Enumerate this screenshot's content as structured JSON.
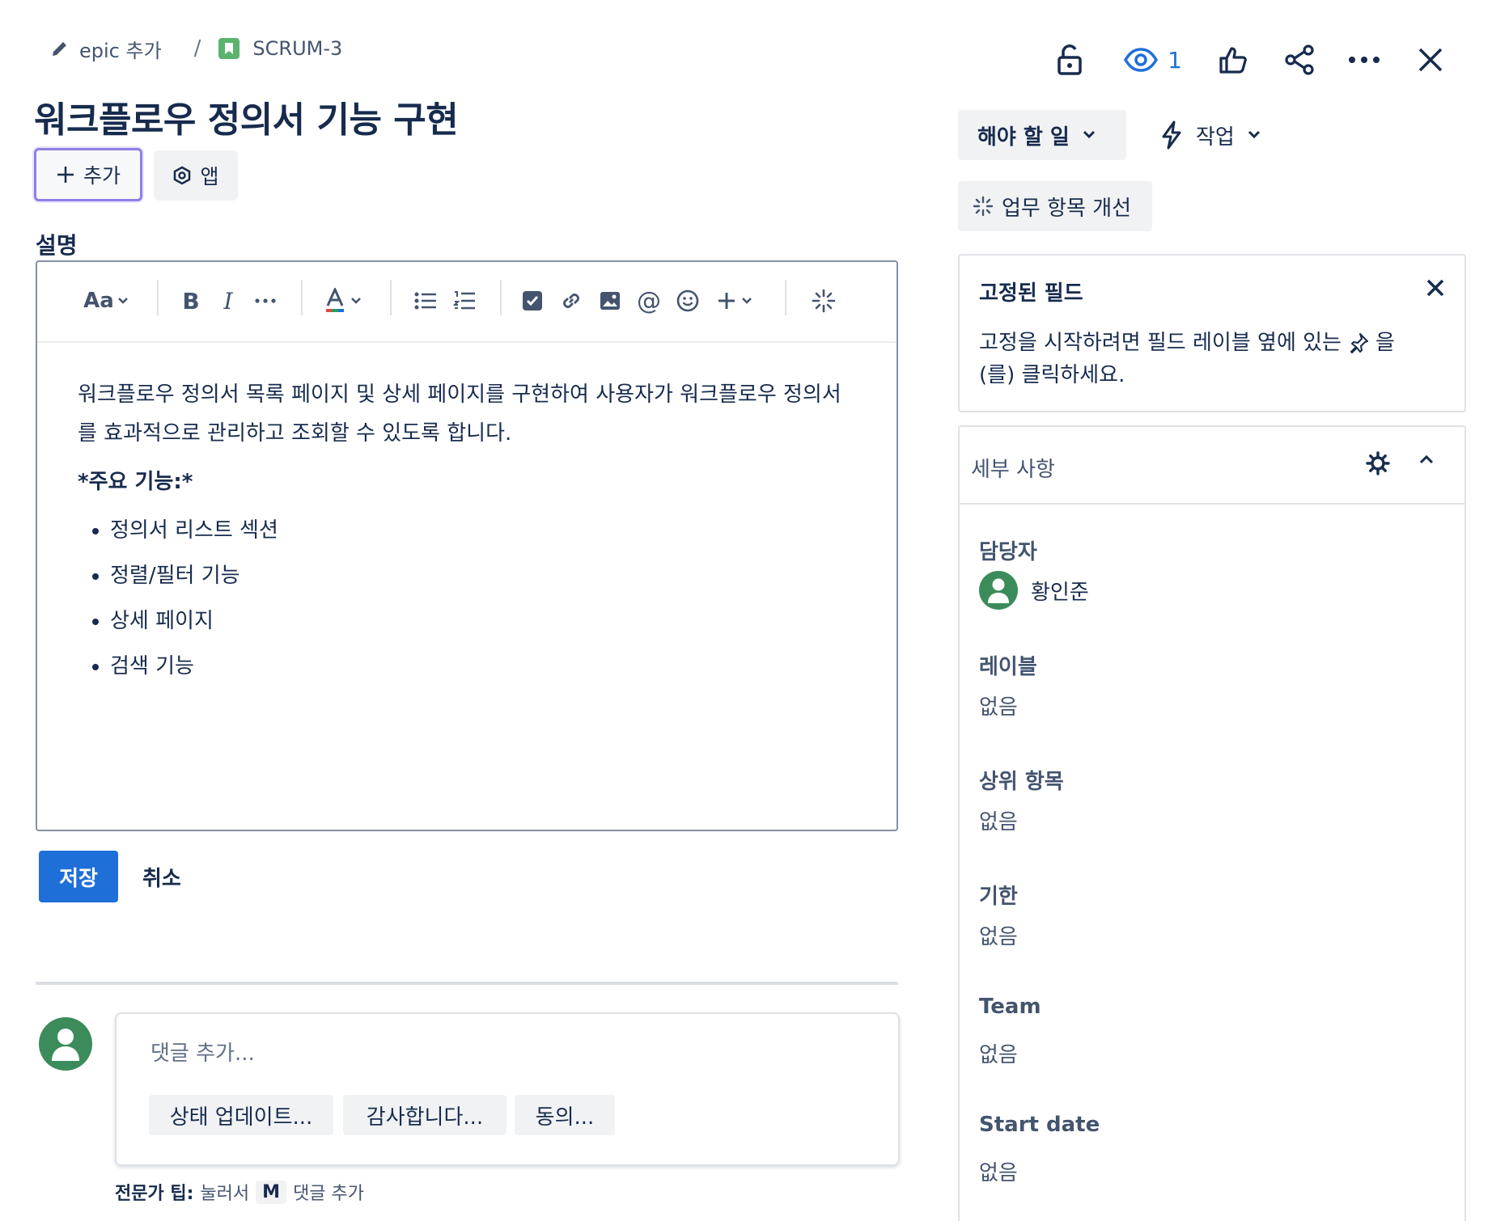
{
  "breadcrumb": {
    "parent_label": "epic 추가",
    "separator": "/",
    "issue_key": "SCRUM-3"
  },
  "header": {
    "watchers_count": "1",
    "icons": [
      "unlock-icon",
      "eye-icon",
      "thumbs-up-icon",
      "share-icon",
      "more-icon",
      "close-icon"
    ]
  },
  "issue": {
    "title": "워크플로우 정의서 기능 구현",
    "add_label": "추가",
    "apps_label": "앱"
  },
  "description": {
    "label": "설명",
    "toolbar": {
      "text_style": "Aa",
      "bold": "B",
      "italic": "I"
    },
    "paragraph": "워크플로우 정의서 목록 페이지 및 상세 페이지를 구현하여 사용자가 워크플로우 정의서를 효과적으로 관리하고 조회할 수 있도록 합니다.",
    "subheading": "*주요 기능:*",
    "bullets": [
      "정의서 리스트 섹션",
      "정렬/필터 기능",
      "상세 페이지",
      "검색 기능"
    ],
    "save_label": "저장",
    "cancel_label": "취소"
  },
  "comment": {
    "placeholder": "댓글 추가...",
    "quick_replies": [
      "상태 업데이트...",
      "감사합니다...",
      "동의..."
    ],
    "tip_prefix": "전문가 팁:",
    "tip_press": "눌러서",
    "tip_key": "M",
    "tip_suffix": "댓글 추가"
  },
  "sidebar": {
    "status_label": "해야 할 일",
    "action_label": "작업",
    "improve_label": "업무 항목 개선",
    "pinned": {
      "title": "고정된 필드",
      "text_before": "고정을 시작하려면 필드 레이블 옆에 있는",
      "text_after": "을",
      "text_line2": "(를) 클릭하세요."
    },
    "details": {
      "title": "세부 사항",
      "assignee_label": "담당자",
      "assignee_name": "황인준",
      "labels_label": "레이블",
      "labels_value": "없음",
      "parent_label": "상위 항목",
      "parent_value": "없음",
      "due_label": "기한",
      "due_value": "없음",
      "team_label": "Team",
      "team_value": "없음",
      "start_label": "Start date",
      "start_value": "없음"
    }
  },
  "colors": {
    "primary": "#1f6fd9",
    "avatar": "#3b8c5a",
    "watch": "#1f6fd9",
    "focus_ring": "#8f7ee7"
  }
}
